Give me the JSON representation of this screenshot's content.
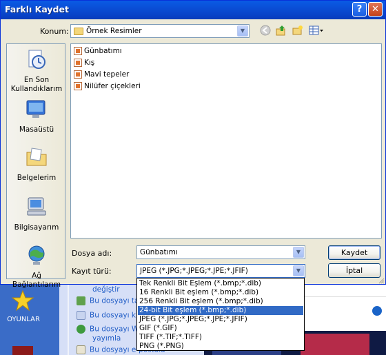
{
  "window": {
    "title": "Farklı Kaydet",
    "help_button": "?",
    "close_button": "✕"
  },
  "location": {
    "label": "Konum:",
    "value": "Örnek Resimler"
  },
  "places": [
    {
      "label": "En Son\nKullandıklarım",
      "icon": "recent-documents-icon"
    },
    {
      "label": "Masaüstü",
      "icon": "desktop-icon"
    },
    {
      "label": "Belgelerim",
      "icon": "my-documents-icon"
    },
    {
      "label": "Bilgisayarım",
      "icon": "my-computer-icon"
    },
    {
      "label": "Ağ Bağlantılarım",
      "icon": "network-places-icon"
    }
  ],
  "files": [
    "Günbatımı",
    "Kış",
    "Mavi tepeler",
    "Nilüfer çiçekleri"
  ],
  "filename": {
    "label": "Dosya adı:",
    "value": "Günbatımı"
  },
  "filetype": {
    "label": "Kayıt türü:",
    "value": "JPEG (*.JPG;*.JPEG;*.JPE;*.JFIF)",
    "options": [
      "Tek Renkli Bit Eşlem (*.bmp;*.dib)",
      "16 Renkli Bit eşlem (*.bmp;*.dib)",
      "256 Renkli Bit eşlem (*.bmp;*.dib)",
      "24-bit Bit eşlem (*.bmp;*.dib)",
      "JPEG (*.JPG;*.JPEG;*.JPE;*.JFIF)",
      "GIF (*.GIF)",
      "TIFF (*.TIF;*.TIFF)",
      "PNG (*.PNG)"
    ],
    "highlighted_index": 3
  },
  "buttons": {
    "save": "Kaydet",
    "cancel": "İptal"
  },
  "background": {
    "desktop_icon_label": "OYUNLAR",
    "tasks": [
      "değiştir",
      "Bu dosyayı ta",
      "Bu dosyayı k",
      "Bu dosyayı W",
      "yayımla",
      "Bu dosyayı e-postala"
    ]
  },
  "colors": {
    "titlebar": "#0a4ed6",
    "selection": "#316ac5",
    "dialog_bg": "#ece9d8"
  }
}
